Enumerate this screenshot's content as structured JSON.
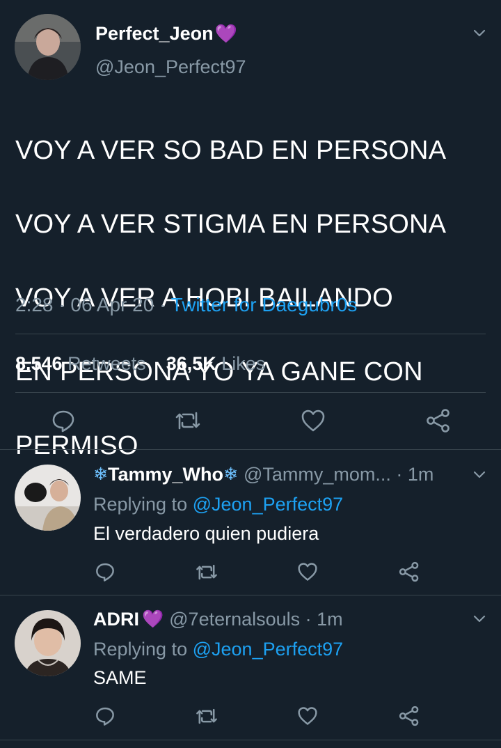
{
  "main_tweet": {
    "display_name": "Perfect_Jeon",
    "name_emoji": "💜",
    "handle": "@Jeon_Perfect97",
    "text_lines": [
      "VOY A VER SO BAD EN PERSONA",
      "VOY A VER STIGMA EN PERSONA",
      "VOY A VER A HOBI BAILANDO",
      "EN PERSONA YO YA GANE CON",
      "PERMISO"
    ],
    "time": "2:28",
    "date": "06 Apr 20",
    "source": "Twitter for Daegubr0s",
    "retweets_count": "8.546",
    "retweets_label": "Retweets",
    "likes_count": "36,5K",
    "likes_label": "Likes"
  },
  "replies": [
    {
      "display_name": "Tammy_Who",
      "name_prefix_emoji": "❄",
      "name_suffix_emoji": "❄",
      "handle": "@Tammy_mom...",
      "time": "1m",
      "replying_label": "Replying to",
      "replying_handle": "@Jeon_Perfect97",
      "text": "El verdadero quien pudiera"
    },
    {
      "display_name": "ADRI",
      "name_suffix_emoji": "💜",
      "handle": "@7eternalsouls",
      "time": "1m",
      "replying_label": "Replying to",
      "replying_handle": "@Jeon_Perfect97",
      "text": "SAME"
    }
  ],
  "colors": {
    "background": "#15202b",
    "muted": "#8899a6",
    "link": "#1da1f2",
    "divider": "#38444d"
  },
  "icons": [
    "reply-icon",
    "retweet-icon",
    "like-icon",
    "share-icon",
    "chevron-down-icon"
  ]
}
